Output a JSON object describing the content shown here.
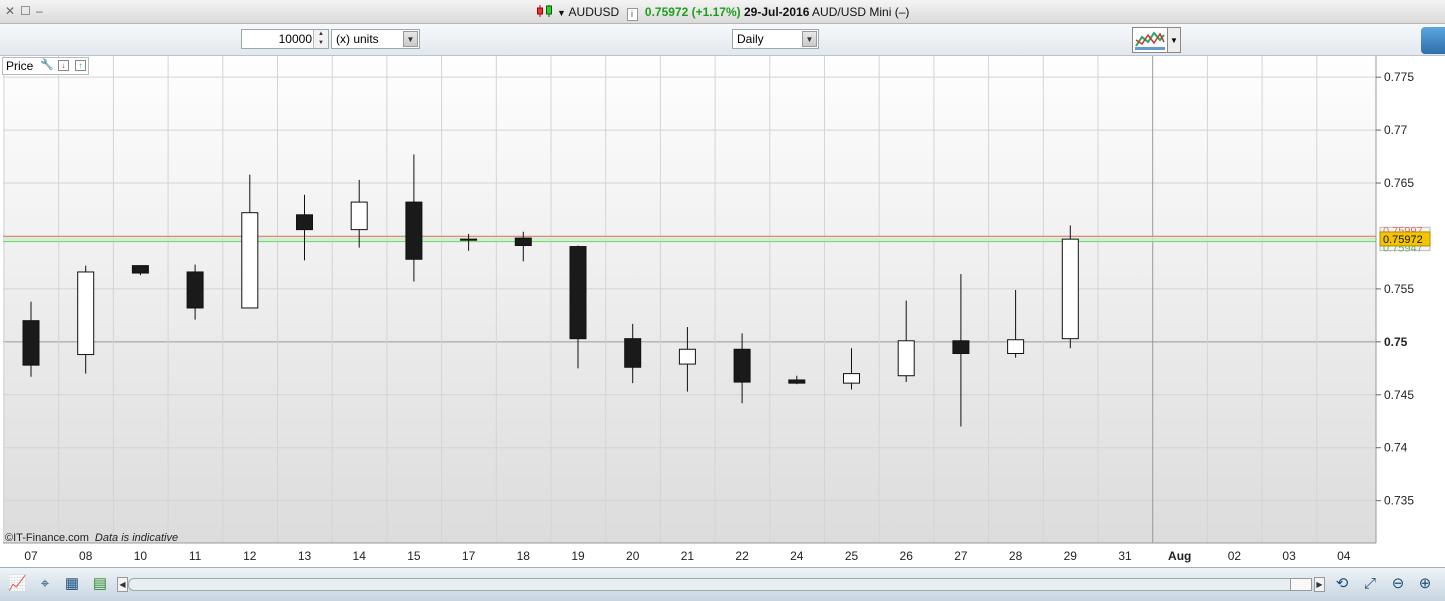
{
  "window": {
    "symbol": "AUDUSD",
    "price": "0.75972",
    "change": "(+1.17%)",
    "date": "29-Jul-2016",
    "name": "AUD/USD Mini (–)"
  },
  "toolbar": {
    "quantity": "10000",
    "units_label": "(x) units",
    "interval": "Daily"
  },
  "panel": {
    "label": "Price"
  },
  "watermark": {
    "brand": "©IT-Finance.com",
    "note": "Data is indicative"
  },
  "colors": {
    "up_fill": "#ffffff",
    "down_fill": "#1a1a1a",
    "bid_line": "#e86b6b",
    "ask_line": "#6fd36f",
    "last_label_bg": "#f5c400"
  },
  "chart_data": {
    "type": "candlestick",
    "y_range": [
      0.731,
      0.777
    ],
    "y_ticks": [
      {
        "value": 0.775,
        "label": "0.775"
      },
      {
        "value": 0.77,
        "label": "0.77"
      },
      {
        "value": 0.765,
        "label": "0.765"
      },
      {
        "value": 0.755,
        "label": "0.755"
      },
      {
        "value": 0.75,
        "label": "0.75"
      },
      {
        "value": 0.745,
        "label": "0.745"
      },
      {
        "value": 0.74,
        "label": "0.74"
      },
      {
        "value": 0.735,
        "label": "0.735"
      }
    ],
    "x_labels": [
      "07",
      "08",
      "10",
      "11",
      "12",
      "13",
      "14",
      "15",
      "17",
      "18",
      "19",
      "20",
      "21",
      "22",
      "24",
      "25",
      "26",
      "27",
      "28",
      "29",
      "31",
      "Aug",
      "02",
      "03",
      "04"
    ],
    "month_marker": "Aug",
    "grid": true,
    "last_price": 0.75972,
    "last_label": "0.75972",
    "bid_price": 0.75997,
    "bid_label": "0.75997",
    "ask_price": 0.75947,
    "ask_label": "0.75947",
    "candles": [
      {
        "date": "07",
        "open": 0.752,
        "high": 0.7538,
        "low": 0.7467,
        "close": 0.7478
      },
      {
        "date": "08",
        "open": 0.7488,
        "high": 0.7572,
        "low": 0.747,
        "close": 0.7566
      },
      {
        "date": "10",
        "open": 0.7572,
        "high": 0.7572,
        "low": 0.7563,
        "close": 0.7565
      },
      {
        "date": "11",
        "open": 0.7566,
        "high": 0.7573,
        "low": 0.7521,
        "close": 0.7532
      },
      {
        "date": "12",
        "open": 0.7532,
        "high": 0.7658,
        "low": 0.7532,
        "close": 0.7622
      },
      {
        "date": "13",
        "open": 0.762,
        "high": 0.7639,
        "low": 0.7577,
        "close": 0.7606
      },
      {
        "date": "14",
        "open": 0.7606,
        "high": 0.7653,
        "low": 0.7589,
        "close": 0.7632
      },
      {
        "date": "15",
        "open": 0.7632,
        "high": 0.7677,
        "low": 0.7557,
        "close": 0.7578
      },
      {
        "date": "17",
        "open": 0.7597,
        "high": 0.7602,
        "low": 0.7586,
        "close": 0.7596
      },
      {
        "date": "18",
        "open": 0.7598,
        "high": 0.7604,
        "low": 0.7576,
        "close": 0.7591
      },
      {
        "date": "19",
        "open": 0.759,
        "high": 0.7591,
        "low": 0.7475,
        "close": 0.7503
      },
      {
        "date": "20",
        "open": 0.7503,
        "high": 0.7517,
        "low": 0.7461,
        "close": 0.7476
      },
      {
        "date": "21",
        "open": 0.7479,
        "high": 0.7514,
        "low": 0.7453,
        "close": 0.7493
      },
      {
        "date": "22",
        "open": 0.7493,
        "high": 0.7508,
        "low": 0.7442,
        "close": 0.7462
      },
      {
        "date": "24",
        "open": 0.7464,
        "high": 0.7468,
        "low": 0.746,
        "close": 0.7461
      },
      {
        "date": "25",
        "open": 0.7461,
        "high": 0.7494,
        "low": 0.7455,
        "close": 0.747
      },
      {
        "date": "26",
        "open": 0.7468,
        "high": 0.7539,
        "low": 0.7462,
        "close": 0.7501
      },
      {
        "date": "27",
        "open": 0.7501,
        "high": 0.7564,
        "low": 0.742,
        "close": 0.7489
      },
      {
        "date": "28",
        "open": 0.7489,
        "high": 0.7549,
        "low": 0.7485,
        "close": 0.7502
      },
      {
        "date": "29",
        "open": 0.7503,
        "high": 0.761,
        "low": 0.7494,
        "close": 0.7597
      }
    ]
  }
}
